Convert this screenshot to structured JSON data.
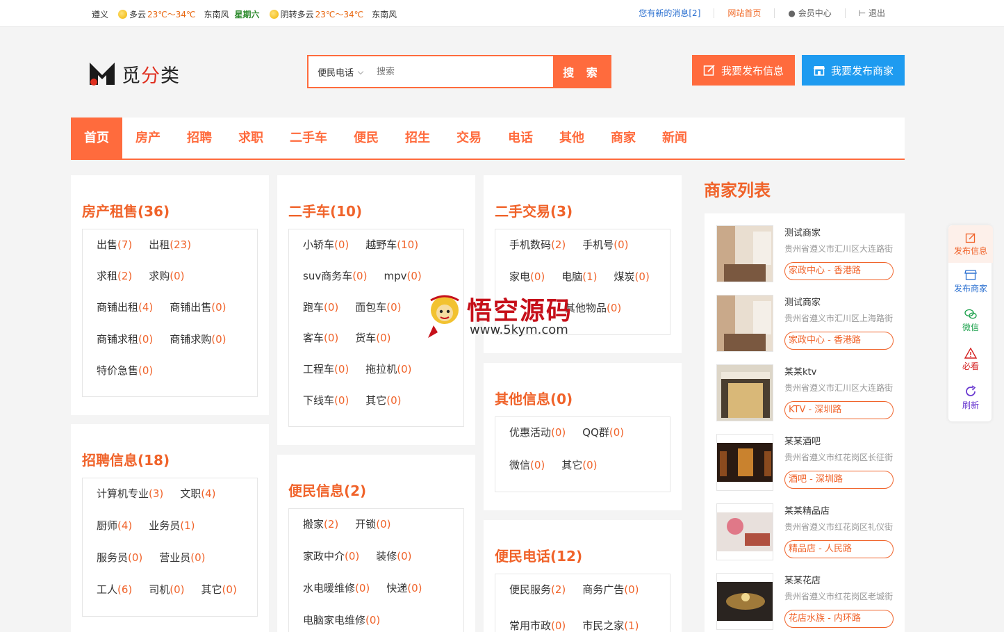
{
  "topbar": {
    "city": "遵义",
    "day1": {
      "weather": "多云",
      "temp": "23℃～34℃",
      "wind": "东南风"
    },
    "weekday": "星期六",
    "day2": {
      "weather": "阴转多云",
      "temp": "23℃～34℃",
      "wind": "东南风"
    },
    "links": {
      "messages": "您有新的消息[2]",
      "home": "网站首页",
      "member": "会员中心",
      "logout": "退出"
    }
  },
  "logo": {
    "text_dark1": "觅",
    "text_red": "分",
    "text_dark2": "类"
  },
  "search": {
    "category": "便民电话",
    "placeholder": "搜索",
    "button": "搜 索"
  },
  "actions": {
    "post_info": "我要发布信息",
    "post_shop": "我要发布商家"
  },
  "colors": {
    "accent": "#ff6b3d",
    "blue": "#1e9bf0",
    "title": "#f0632a"
  },
  "nav": [
    "首页",
    "房产",
    "招聘",
    "求职",
    "二手车",
    "便民",
    "招生",
    "交易",
    "电话",
    "其他",
    "商家",
    "新闻"
  ],
  "panels": {
    "house": {
      "title": "房产租售(36)",
      "items": [
        [
          "出售",
          "(7)"
        ],
        [
          "出租",
          "(23)"
        ],
        [
          "求租",
          "(2)"
        ],
        [
          "求购",
          "(0)"
        ],
        [
          "商铺出租",
          "(4)"
        ],
        [
          "商铺出售",
          "(0)"
        ],
        [
          "商铺求租",
          "(0)"
        ],
        [
          "商铺求购",
          "(0)"
        ],
        [
          "特价急售",
          "(0)"
        ]
      ]
    },
    "jobs": {
      "title": "招聘信息(18)",
      "items": [
        [
          "计算机专业",
          "(3)"
        ],
        [
          "文职",
          "(4)"
        ],
        [
          "厨师",
          "(4)"
        ],
        [
          "业务员",
          "(1)"
        ],
        [
          "服务员",
          "(0)"
        ],
        [
          "营业员",
          "(0)"
        ],
        [
          "工人",
          "(6)"
        ],
        [
          "司机",
          "(0)"
        ],
        [
          "其它",
          "(0)"
        ]
      ]
    },
    "cars": {
      "title": "二手车(10)",
      "items": [
        [
          "小轿车",
          "(0)"
        ],
        [
          "越野车",
          "(10)"
        ],
        [
          "suv商务车",
          "(0)"
        ],
        [
          "mpv",
          "(0)"
        ],
        [
          "跑车",
          "(0)"
        ],
        [
          "面包车",
          "(0)"
        ],
        [
          "客车",
          "(0)"
        ],
        [
          "货车",
          "(0)"
        ],
        [
          "工程车",
          "(0)"
        ],
        [
          "拖拉机",
          "(0)"
        ],
        [
          "下线车",
          "(0)"
        ],
        [
          "其它",
          "(0)"
        ]
      ]
    },
    "service": {
      "title": "便民信息(2)",
      "items": [
        [
          "搬家",
          "(2)"
        ],
        [
          "开锁",
          "(0)"
        ],
        [
          "家政中介",
          "(0)"
        ],
        [
          "装修",
          "(0)"
        ],
        [
          "水电暖维修",
          "(0)"
        ],
        [
          "快递",
          "(0)"
        ],
        [
          "电脑家电维修",
          "(0)"
        ]
      ]
    },
    "trade": {
      "title": "二手交易(3)",
      "items": [
        [
          "手机数码",
          "(2)"
        ],
        [
          "手机号",
          "(0)"
        ],
        [
          "家电",
          "(0)"
        ],
        [
          "电脑",
          "(1)"
        ],
        [
          "煤炭",
          "(0)"
        ],
        [
          "",
          ""
        ],
        [
          "其他物品",
          "(0)"
        ]
      ]
    },
    "other": {
      "title": "其他信息(0)",
      "items": [
        [
          "优惠活动",
          "(0)"
        ],
        [
          "QQ群",
          "(0)"
        ],
        [
          "微信",
          "(0)"
        ],
        [
          "其它",
          "(0)"
        ]
      ]
    },
    "phone": {
      "title": "便民电话(12)",
      "items": [
        [
          "便民服务",
          "(2)"
        ],
        [
          "商务广告",
          "(0)"
        ],
        [
          "常用市政",
          "(0)"
        ],
        [
          "市民之家",
          "(1)"
        ]
      ]
    }
  },
  "shops": {
    "title": "商家列表",
    "items": [
      {
        "name": "测试商家",
        "addr": "贵州省遵义市汇川区大连路街",
        "tag": "家政中心 - 香港路"
      },
      {
        "name": "测试商家",
        "addr": "贵州省遵义市汇川区上海路街",
        "tag": "家政中心 - 香港路"
      },
      {
        "name": "某某ktv",
        "addr": "贵州省遵义市汇川区大连路街",
        "tag": "KTV - 深圳路"
      },
      {
        "name": "某某酒吧",
        "addr": "贵州省遵义市红花岗区长征街",
        "tag": "酒吧 - 深圳路"
      },
      {
        "name": "某某精品店",
        "addr": "贵州省遵义市红花岗区礼仪街",
        "tag": "精品店 - 人民路"
      },
      {
        "name": "某某花店",
        "addr": "贵州省遵义市红花岗区老城街",
        "tag": "花店水族 - 内环路"
      }
    ]
  },
  "sidebar": {
    "post_info": "发布信息",
    "post_shop": "发布商家",
    "wechat": "微信",
    "must_see": "必看",
    "refresh": "刷新"
  },
  "watermark": {
    "text": "悟空源码",
    "url": "www.5kym.com"
  }
}
